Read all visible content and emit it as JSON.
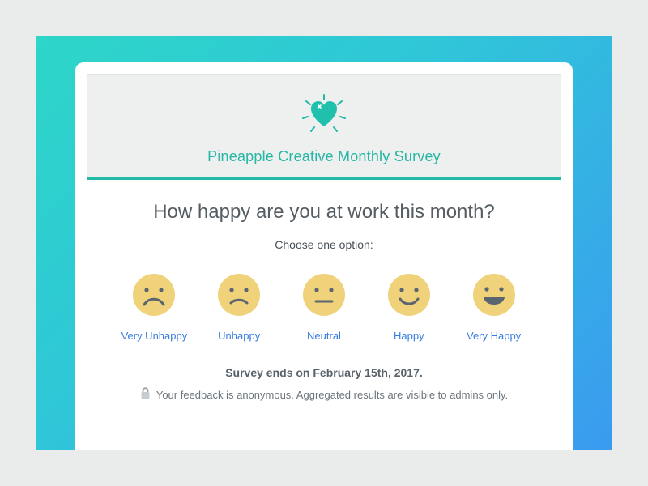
{
  "colors": {
    "accent": "#22b9a7",
    "link": "#3a7de0",
    "text": "#555d63",
    "face": "#f0d27a",
    "faceStroke": "#5a6570"
  },
  "banner": {
    "title": "Pineapple Creative Monthly Survey"
  },
  "survey": {
    "question": "How happy are you at work this month?",
    "instruction": "Choose one option:",
    "options": [
      {
        "key": "very-unhappy",
        "label": "Very Unhappy",
        "icon": "face-very-unhappy"
      },
      {
        "key": "unhappy",
        "label": "Unhappy",
        "icon": "face-unhappy"
      },
      {
        "key": "neutral",
        "label": "Neutral",
        "icon": "face-neutral"
      },
      {
        "key": "happy",
        "label": "Happy",
        "icon": "face-happy"
      },
      {
        "key": "very-happy",
        "label": "Very Happy",
        "icon": "face-very-happy"
      }
    ],
    "deadline": "Survey ends on February 15th, 2017.",
    "privacy": "Your feedback is anonymous. Aggregated results are visible to admins only."
  }
}
